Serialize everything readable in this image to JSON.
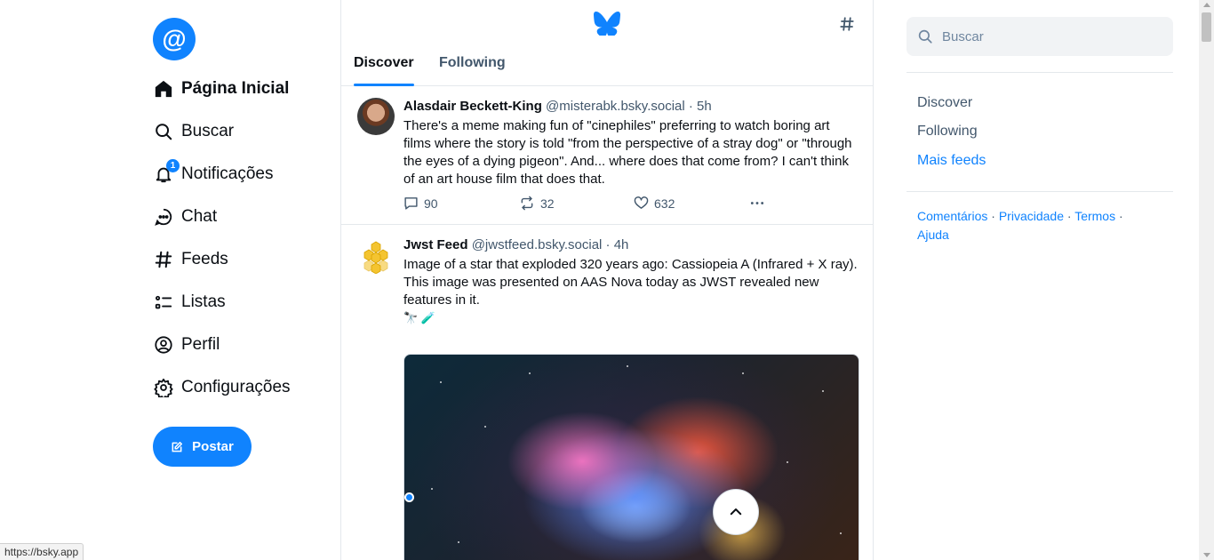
{
  "nav": {
    "items": [
      {
        "label": "Página Inicial",
        "icon": "home-icon",
        "active": true
      },
      {
        "label": "Buscar",
        "icon": "search-icon"
      },
      {
        "label": "Notificações",
        "icon": "bell-icon",
        "badge": "1"
      },
      {
        "label": "Chat",
        "icon": "chat-icon"
      },
      {
        "label": "Feeds",
        "icon": "hash-icon"
      },
      {
        "label": "Listas",
        "icon": "list-icon"
      },
      {
        "label": "Perfil",
        "icon": "user-circle-icon"
      },
      {
        "label": "Configurações",
        "icon": "gear-icon"
      }
    ],
    "post_label": "Postar"
  },
  "header": {
    "tabs": [
      {
        "label": "Discover",
        "active": true
      },
      {
        "label": "Following",
        "active": false
      }
    ]
  },
  "feed": {
    "posts": [
      {
        "name": "Alasdair Beckett-King",
        "handle": "@misterabk.bsky.social",
        "time": "· 5h",
        "text": "There's a meme making fun of \"cinephiles\" preferring to watch boring art films where the story is told \"from the perspective of a stray dog\" or \"through the eyes of a dying pigeon\". And... where does that come from? I can't think of an art house film that does that.",
        "replies": "90",
        "reposts": "32",
        "likes": "632"
      },
      {
        "name": "Jwst Feed",
        "handle": "@jwstfeed.bsky.social",
        "time": "· 4h",
        "text_line1": "Image of a star that exploded 320 years ago: Cassiopeia A (Infrared + X ray).",
        "text_line2": "This image was presented on AAS Nova today as JWST revealed new features in it.",
        "emoji": "🔭 🧪"
      }
    ]
  },
  "right": {
    "search_placeholder": "Buscar",
    "feeds": [
      "Discover",
      "Following"
    ],
    "more_feeds": "Mais feeds",
    "footer": [
      "Comentários",
      "Privacidade",
      "Termos",
      "Ajuda"
    ]
  },
  "status_url": "https://bsky.app",
  "colors": {
    "accent": "#1083fe",
    "muted": "#42576c",
    "border": "#e4e8ec"
  }
}
